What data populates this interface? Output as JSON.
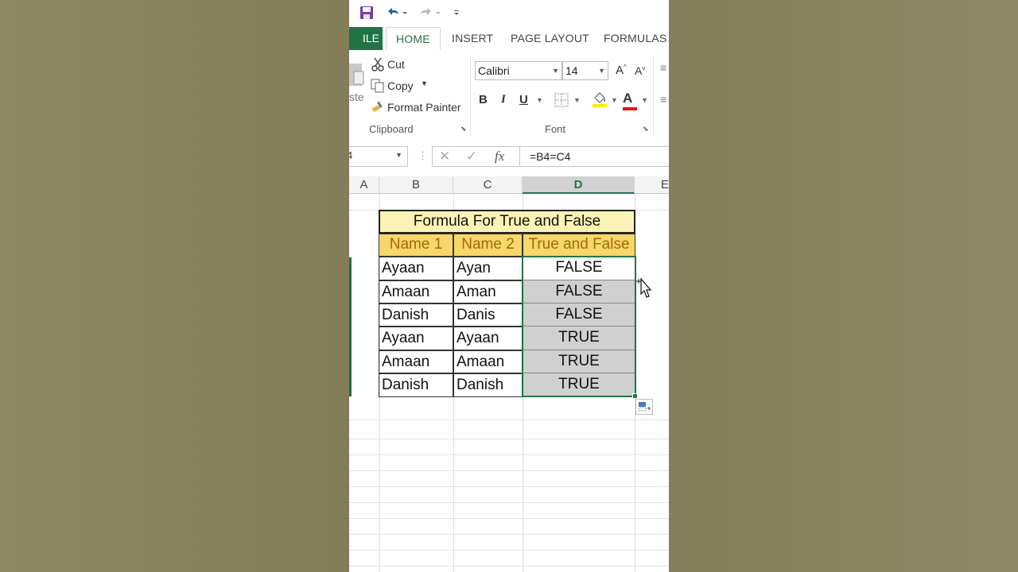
{
  "tabs": {
    "file": "ILE",
    "home": "HOME",
    "insert": "INSERT",
    "page_layout": "PAGE LAYOUT",
    "formulas": "FORMULAS"
  },
  "clipboard": {
    "paste": "ste",
    "cut": "Cut",
    "copy": "Copy",
    "format_painter": "Format Painter",
    "group_label": "Clipboard"
  },
  "font": {
    "name": "Calibri",
    "size": "14",
    "group_label": "Font",
    "bold": "B",
    "italic": "I",
    "underline": "U",
    "grow": "A",
    "shrink": "A",
    "color_letter": "A"
  },
  "formula_bar": {
    "namebox": "4",
    "fx": "fx",
    "formula": "=B4=C4"
  },
  "columns": [
    "A",
    "B",
    "C",
    "D",
    "E"
  ],
  "table": {
    "title": "Formula For True and False",
    "headers": [
      "Name 1",
      "Name 2",
      "True and False"
    ],
    "rows": [
      [
        "Ayaan",
        "Ayan",
        "FALSE"
      ],
      [
        "Amaan",
        "Aman",
        "FALSE"
      ],
      [
        "Danish",
        "Danis",
        "FALSE"
      ],
      [
        "Ayaan",
        "Ayaan",
        "TRUE"
      ],
      [
        "Amaan",
        "Amaan",
        "TRUE"
      ],
      [
        "Danish",
        "Danish",
        "TRUE"
      ]
    ]
  },
  "colors": {
    "accent": "#217346",
    "title_fill": "#fbf3b5",
    "header_fill": "#f7d66a",
    "header_text": "#a26b00",
    "selection_fill": "#d0d0d0"
  }
}
